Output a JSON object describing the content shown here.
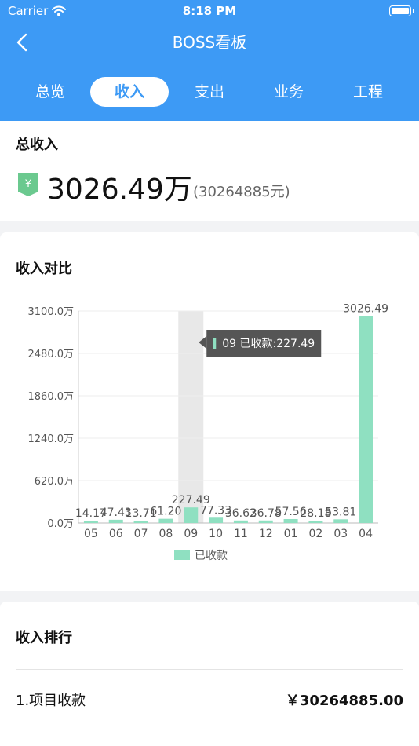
{
  "status_bar": {
    "carrier": "Carrier",
    "time": "8:18 PM"
  },
  "nav": {
    "title": "BOSS看板"
  },
  "tabs": [
    {
      "label": "总览",
      "active": false
    },
    {
      "label": "收入",
      "active": true
    },
    {
      "label": "支出",
      "active": false
    },
    {
      "label": "业务",
      "active": false
    },
    {
      "label": "工程",
      "active": false
    }
  ],
  "total": {
    "title": "总收入",
    "icon": "yen-shield-icon",
    "icon_glyph": "¥",
    "amount": "3026.49万",
    "amount_full": "(30264885元)"
  },
  "comparison": {
    "title": "收入对比",
    "tooltip": "09 已收款:227.49",
    "tooltip_category": "09",
    "chart_data": {
      "type": "bar",
      "categories": [
        "05",
        "06",
        "07",
        "08",
        "09",
        "10",
        "11",
        "12",
        "01",
        "02",
        "03",
        "04"
      ],
      "series": [
        {
          "name": "已收款",
          "values": [
            14.17,
            47.43,
            13.71,
            61.2,
            227.49,
            77.33,
            36.62,
            36.78,
            57.56,
            28.18,
            53.81,
            3026.49
          ],
          "labels": [
            "14.17",
            "47.43",
            "13.71",
            "61.20",
            "227.49",
            "77.33",
            "36.62",
            "36.78",
            "57.56",
            "28.18",
            "53.81",
            "3026.49"
          ]
        }
      ],
      "y_ticks": [
        "0.0万",
        "620.0万",
        "1240.0万",
        "1860.0万",
        "2480.0万",
        "3100.0万"
      ],
      "ylim": [
        0,
        3100
      ],
      "legend": "bottom-center",
      "grid": true,
      "color": "#8fe0c1"
    }
  },
  "ranking": {
    "title": "收入排行",
    "items": [
      {
        "name": "1.项目收款",
        "value": "￥30264885.00"
      }
    ]
  },
  "colors": {
    "header": "#3d9af5",
    "bar": "#8fe0c1",
    "icon": "#6bc98f"
  }
}
